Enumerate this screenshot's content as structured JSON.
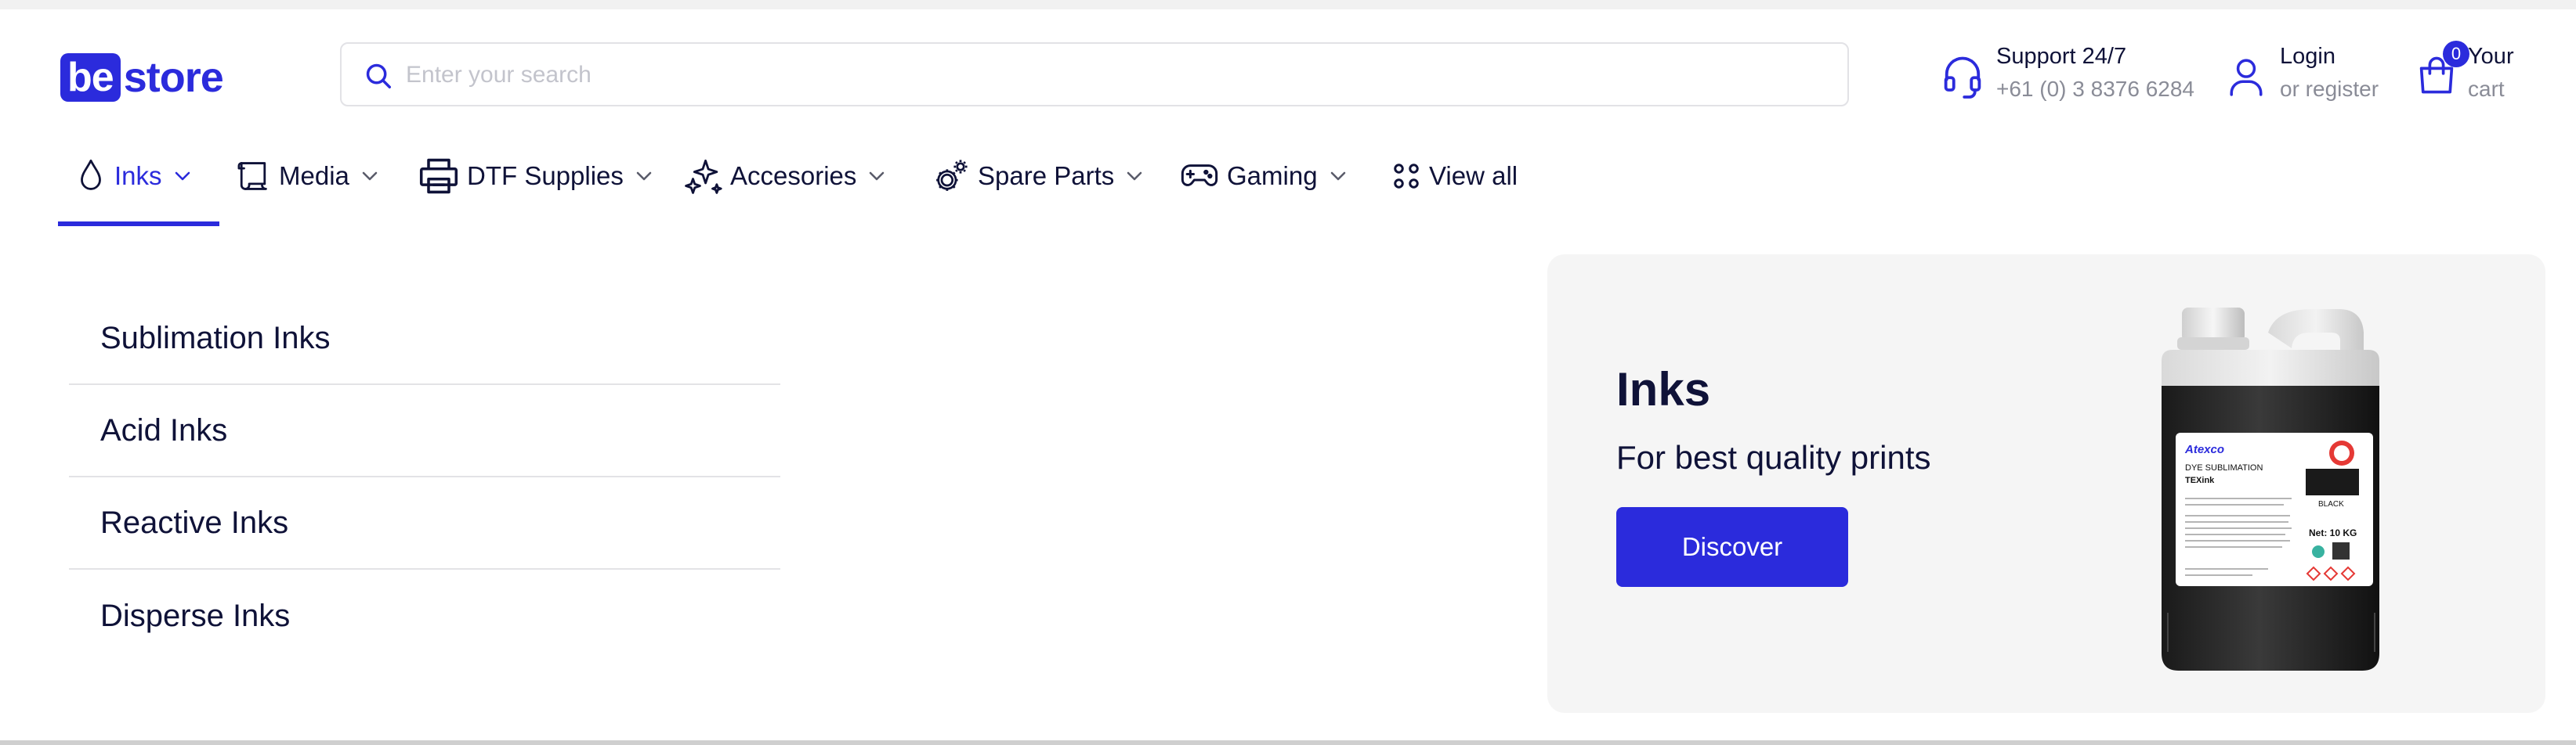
{
  "brand": {
    "logo_box": "be",
    "logo_text": "store",
    "accent": "#2b2bdc"
  },
  "search": {
    "placeholder": "Enter your search",
    "value": ""
  },
  "header": {
    "support": {
      "title": "Support 24/7",
      "phone": "+61 (0) 3 8376 6284",
      "icon": "headset-icon"
    },
    "account": {
      "title": "Login",
      "subtitle": "or register",
      "icon": "user-icon"
    },
    "cart": {
      "title": "Your",
      "subtitle": "cart",
      "count": "0",
      "icon": "shopping-bag-icon"
    }
  },
  "nav": {
    "items": [
      {
        "label": "Inks",
        "icon": "droplet-icon",
        "active": true
      },
      {
        "label": "Media",
        "icon": "scroll-icon"
      },
      {
        "label": "DTF Supplies",
        "icon": "printer-icon"
      },
      {
        "label": "Accesories",
        "icon": "sparkles-icon"
      },
      {
        "label": "Spare Parts",
        "icon": "gears-icon"
      },
      {
        "label": "Gaming",
        "icon": "gamepad-icon"
      },
      {
        "label": "View all",
        "icon": "grid-dots-icon"
      }
    ]
  },
  "submenu": {
    "items": [
      "Sublimation Inks",
      "Acid Inks",
      "Reactive Inks",
      "Disperse Inks"
    ]
  },
  "promo": {
    "title": "Inks",
    "subtitle": "For best quality prints",
    "button": "Discover",
    "product_label": {
      "brand": "Atexco",
      "line1": "DYE SUBLIMATION",
      "line2": "TEXink",
      "net": "Net: 10 KG",
      "color": "BLACK"
    }
  }
}
